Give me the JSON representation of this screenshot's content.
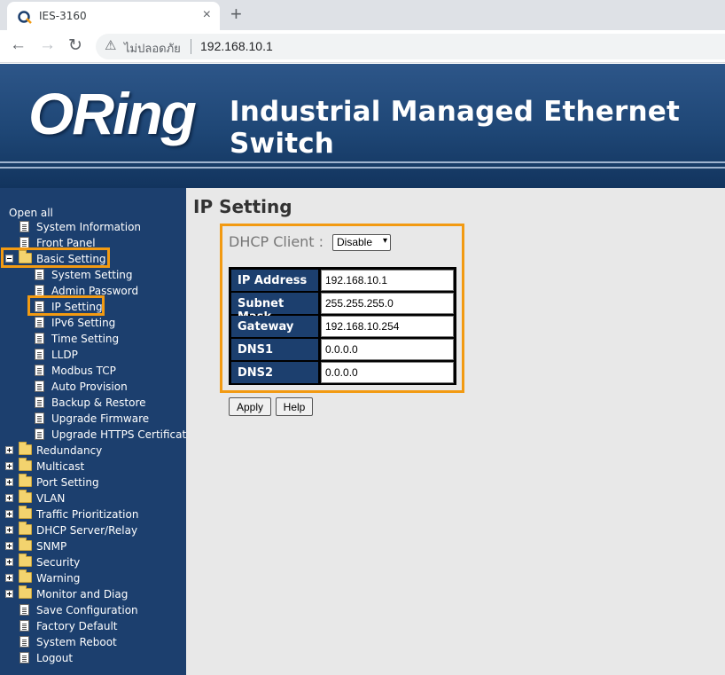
{
  "browser": {
    "tab_title": "IES-3160",
    "tab_close": "×",
    "new_tab": "+",
    "back": "←",
    "forward": "→",
    "reload": "↻",
    "security_warning": "ไม่ปลอดภัย",
    "url": "192.168.10.1"
  },
  "banner": {
    "logo": "ORing",
    "title": "Industrial Managed Ethernet Switch"
  },
  "sidebar": {
    "open_all": "Open all",
    "items": [
      {
        "label": "System Information"
      },
      {
        "label": "Front Panel"
      },
      {
        "label": "Basic Setting"
      },
      {
        "label": "System Setting"
      },
      {
        "label": "Admin Password"
      },
      {
        "label": "IP Setting"
      },
      {
        "label": "IPv6 Setting"
      },
      {
        "label": "Time Setting"
      },
      {
        "label": "LLDP"
      },
      {
        "label": "Modbus TCP"
      },
      {
        "label": "Auto Provision"
      },
      {
        "label": "Backup & Restore"
      },
      {
        "label": "Upgrade Firmware"
      },
      {
        "label": "Upgrade HTTPS Certificatio"
      },
      {
        "label": "Redundancy"
      },
      {
        "label": "Multicast"
      },
      {
        "label": "Port Setting"
      },
      {
        "label": "VLAN"
      },
      {
        "label": "Traffic Prioritization"
      },
      {
        "label": "DHCP Server/Relay"
      },
      {
        "label": "SNMP"
      },
      {
        "label": "Security"
      },
      {
        "label": "Warning"
      },
      {
        "label": "Monitor and Diag"
      },
      {
        "label": "Save Configuration"
      },
      {
        "label": "Factory Default"
      },
      {
        "label": "System Reboot"
      },
      {
        "label": "Logout"
      }
    ]
  },
  "main": {
    "title": "IP Setting",
    "dhcp_label": "DHCP Client :",
    "dhcp_value": "Disable",
    "fields": [
      {
        "label": "IP Address",
        "value": "192.168.10.1"
      },
      {
        "label": "Subnet Mask",
        "value": "255.255.255.0"
      },
      {
        "label": "Gateway",
        "value": "192.168.10.254"
      },
      {
        "label": "DNS1",
        "value": "0.0.0.0"
      },
      {
        "label": "DNS2",
        "value": "0.0.0.0"
      }
    ],
    "apply_label": "Apply",
    "help_label": "Help"
  },
  "colors": {
    "accent_highlight": "#f29a12",
    "sidebar_bg": "#1c3f6e",
    "banner_bg": "#1e4675"
  }
}
